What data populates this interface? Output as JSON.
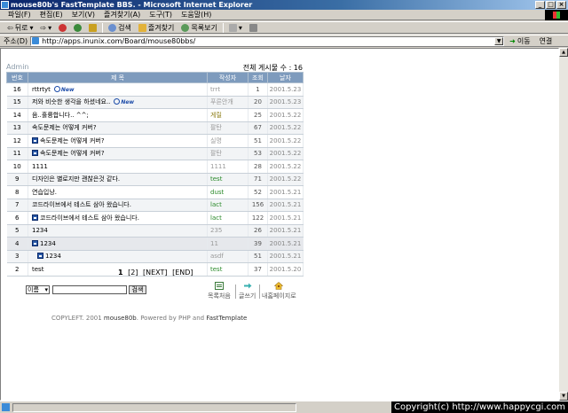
{
  "window": {
    "title": "mouse80b's FastTemplate BBS. - Microsoft Internet Explorer"
  },
  "menu": [
    "파일(F)",
    "편집(E)",
    "보기(V)",
    "즐겨찾기(A)",
    "도구(T)",
    "도움말(H)"
  ],
  "toolbar": {
    "back": "뒤로",
    "search": "검색",
    "favorites": "즐겨찾기",
    "history": "목록보기"
  },
  "address": {
    "label": "주소(D)",
    "url": "http://apps.inunix.com/Board/mouse80bbs/",
    "go": "이동",
    "links": "연결"
  },
  "page": {
    "admin": "Admin",
    "total": "전체 게시물 수 : 16",
    "columns": [
      "번호",
      "제 목",
      "작성자",
      "조회",
      "날자"
    ],
    "rows": [
      {
        "num": "16",
        "subject": "rttrtyt",
        "new": true,
        "reply": 0,
        "author": "trrt",
        "hits": "1",
        "date": "2001.5.23"
      },
      {
        "num": "15",
        "subject": "저와 비슷한 생각을 하셨네요..",
        "new": true,
        "reply": 0,
        "author": "푸른안개",
        "hits": "20",
        "date": "2001.5.23"
      },
      {
        "num": "14",
        "subject": "음..훌륭합니다.. ^^;",
        "new": false,
        "reply": 0,
        "author": "게릴",
        "hits": "25",
        "date": "2001.5.22"
      },
      {
        "num": "13",
        "subject": "속도문제는 어떻게 커버?",
        "new": false,
        "reply": 0,
        "author": "팔탄",
        "hits": "67",
        "date": "2001.5.22"
      },
      {
        "num": "12",
        "subject": "속도문제는 어떻게 커버?",
        "new": false,
        "reply": 1,
        "author": "실명",
        "hits": "51",
        "date": "2001.5.22"
      },
      {
        "num": "11",
        "subject": "속도문제는 어떻게 커버?",
        "new": false,
        "reply": 1,
        "author": "팔탄",
        "hits": "53",
        "date": "2001.5.22"
      },
      {
        "num": "10",
        "subject": "1111",
        "new": false,
        "reply": 0,
        "author": "1111",
        "hits": "28",
        "date": "2001.5.22"
      },
      {
        "num": "9",
        "subject": "디자인은 별로지만 괜찮은것 같다.",
        "new": false,
        "reply": 0,
        "author": "test",
        "hits": "71",
        "date": "2001.5.22"
      },
      {
        "num": "8",
        "subject": "연습입낭.",
        "new": false,
        "reply": 0,
        "author": "dust",
        "hits": "52",
        "date": "2001.5.21"
      },
      {
        "num": "7",
        "subject": "코드라이브에서 테스트 삼아 왔습니다.",
        "new": false,
        "reply": 0,
        "author": "lact",
        "hits": "156",
        "date": "2001.5.21"
      },
      {
        "num": "6",
        "subject": "코드라이브에서 테스트 삼아 왔습니다.",
        "new": false,
        "reply": 1,
        "author": "lact",
        "hits": "122",
        "date": "2001.5.21"
      },
      {
        "num": "5",
        "subject": "1234",
        "new": false,
        "reply": 0,
        "author": "235",
        "hits": "26",
        "date": "2001.5.21"
      },
      {
        "num": "4",
        "subject": "1234",
        "new": false,
        "reply": 1,
        "author": "11",
        "hits": "39",
        "date": "2001.5.21"
      },
      {
        "num": "3",
        "subject": "1234",
        "new": false,
        "reply": 2,
        "author": "asdf",
        "hits": "51",
        "date": "2001.5.21"
      },
      {
        "num": "2",
        "subject": "test",
        "new": false,
        "reply": 0,
        "author": "test",
        "hits": "37",
        "date": "2001.5.20"
      }
    ],
    "pager": {
      "current": "1",
      "page2": "[2]",
      "next": "[NEXT]",
      "end": "[END]"
    },
    "search": {
      "field": "이름",
      "button": "검색"
    },
    "actions": {
      "list": "목록처음",
      "write": "글쓰기",
      "home": "내홈페이지로"
    },
    "footer": {
      "prefix": "COPYLEFT. 2001 ",
      "author": "mouse80b",
      "mid": ". Powered by PHP and ",
      "tpl": "FastTemplate"
    },
    "new_badge": "New"
  },
  "status": {
    "copyright": "Copyright(c) http://www.happycgi.com"
  }
}
